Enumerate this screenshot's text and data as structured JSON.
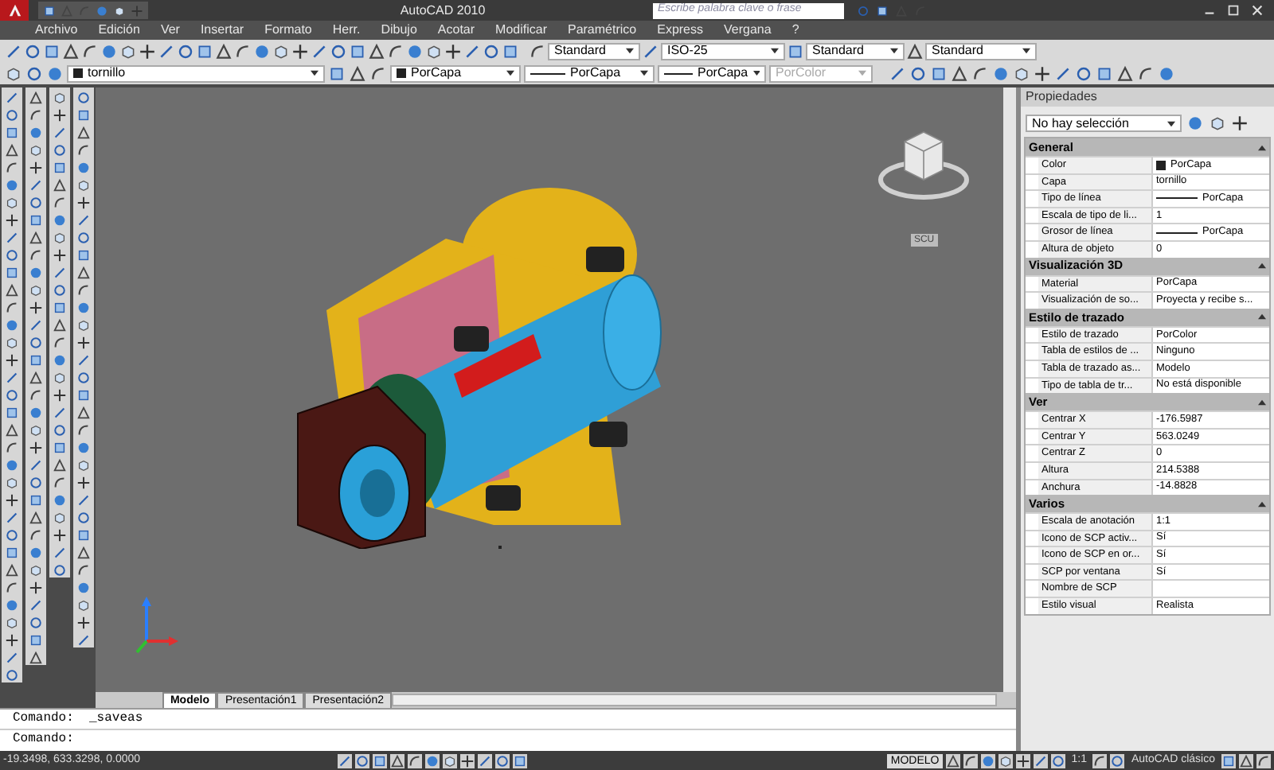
{
  "window": {
    "title": "AutoCAD 2010"
  },
  "search": {
    "placeholder": "Escribe palabra clave o frase"
  },
  "menu": [
    "Archivo",
    "Edición",
    "Ver",
    "Insertar",
    "Formato",
    "Herr.",
    "Dibujo",
    "Acotar",
    "Modificar",
    "Paramétrico",
    "Express",
    "Vergana",
    "?"
  ],
  "style_toolbar": {
    "text_style": "Standard",
    "dim_style": "ISO-25",
    "table_style": "Standard",
    "multileader_style": "Standard"
  },
  "layers_toolbar": {
    "layer": "tornillo",
    "color_setting": "PorCapa",
    "linetype": "PorCapa",
    "lineweight": "PorCapa",
    "plot_style": "PorColor",
    "plot_style_disabled": true
  },
  "viewport": {
    "viewcube_label": "SCU"
  },
  "layout_tabs": [
    {
      "label": "Modelo",
      "selected": true
    },
    {
      "label": "Presentación1",
      "selected": false
    },
    {
      "label": "Presentación2",
      "selected": false
    }
  ],
  "command_line": {
    "history": "Comando:  _saveas",
    "prompt": "Comando:"
  },
  "status_bar": {
    "coordinates": "-19.3498, 633.3298, 0.0000",
    "space": "MODELO",
    "annotation_scale": "1:1",
    "workspace": "AutoCAD clásico"
  },
  "properties": {
    "title": "Propiedades",
    "selection": "No hay selección",
    "sections": [
      {
        "name": "General",
        "expanded": true,
        "rows": [
          {
            "label": "Color",
            "value": "PorCapa",
            "kind": "swatch"
          },
          {
            "label": "Capa",
            "value": "tornillo",
            "kind": "text"
          },
          {
            "label": "Tipo de línea",
            "value": "PorCapa",
            "kind": "line"
          },
          {
            "label": "Escala de tipo de li...",
            "value": "1",
            "kind": "text"
          },
          {
            "label": "Grosor de línea",
            "value": "PorCapa",
            "kind": "line"
          },
          {
            "label": "Altura de objeto",
            "value": "0",
            "kind": "text"
          }
        ]
      },
      {
        "name": "Visualización 3D",
        "expanded": true,
        "rows": [
          {
            "label": "Material",
            "value": "PorCapa",
            "kind": "text"
          },
          {
            "label": "Visualización de so...",
            "value": "Proyecta y recibe s...",
            "kind": "text"
          }
        ]
      },
      {
        "name": "Estilo de trazado",
        "expanded": true,
        "rows": [
          {
            "label": "Estilo de trazado",
            "value": "PorColor",
            "kind": "text"
          },
          {
            "label": "Tabla de estilos de ...",
            "value": "Ninguno",
            "kind": "text"
          },
          {
            "label": "Tabla de trazado as...",
            "value": "Modelo",
            "kind": "text"
          },
          {
            "label": "Tipo de tabla de tr...",
            "value": "No está disponible",
            "kind": "text"
          }
        ]
      },
      {
        "name": "Ver",
        "expanded": true,
        "rows": [
          {
            "label": "Centrar X",
            "value": "-176.5987",
            "kind": "text"
          },
          {
            "label": "Centrar Y",
            "value": "563.0249",
            "kind": "text"
          },
          {
            "label": "Centrar Z",
            "value": "0",
            "kind": "text"
          },
          {
            "label": "Altura",
            "value": "214.5388",
            "kind": "text"
          },
          {
            "label": "Anchura",
            "value": "-14.8828",
            "kind": "text"
          }
        ]
      },
      {
        "name": "Varios",
        "expanded": true,
        "rows": [
          {
            "label": "Escala de anotación",
            "value": "1:1",
            "kind": "text"
          },
          {
            "label": "Icono de SCP activ...",
            "value": "Sí",
            "kind": "text"
          },
          {
            "label": "Icono de SCP en or...",
            "value": "Sí",
            "kind": "text"
          },
          {
            "label": "SCP por ventana",
            "value": "Sí",
            "kind": "text"
          },
          {
            "label": "Nombre de SCP",
            "kind": "text"
          },
          {
            "label": "Estilo visual",
            "value": "Realista",
            "kind": "text"
          }
        ]
      }
    ]
  }
}
